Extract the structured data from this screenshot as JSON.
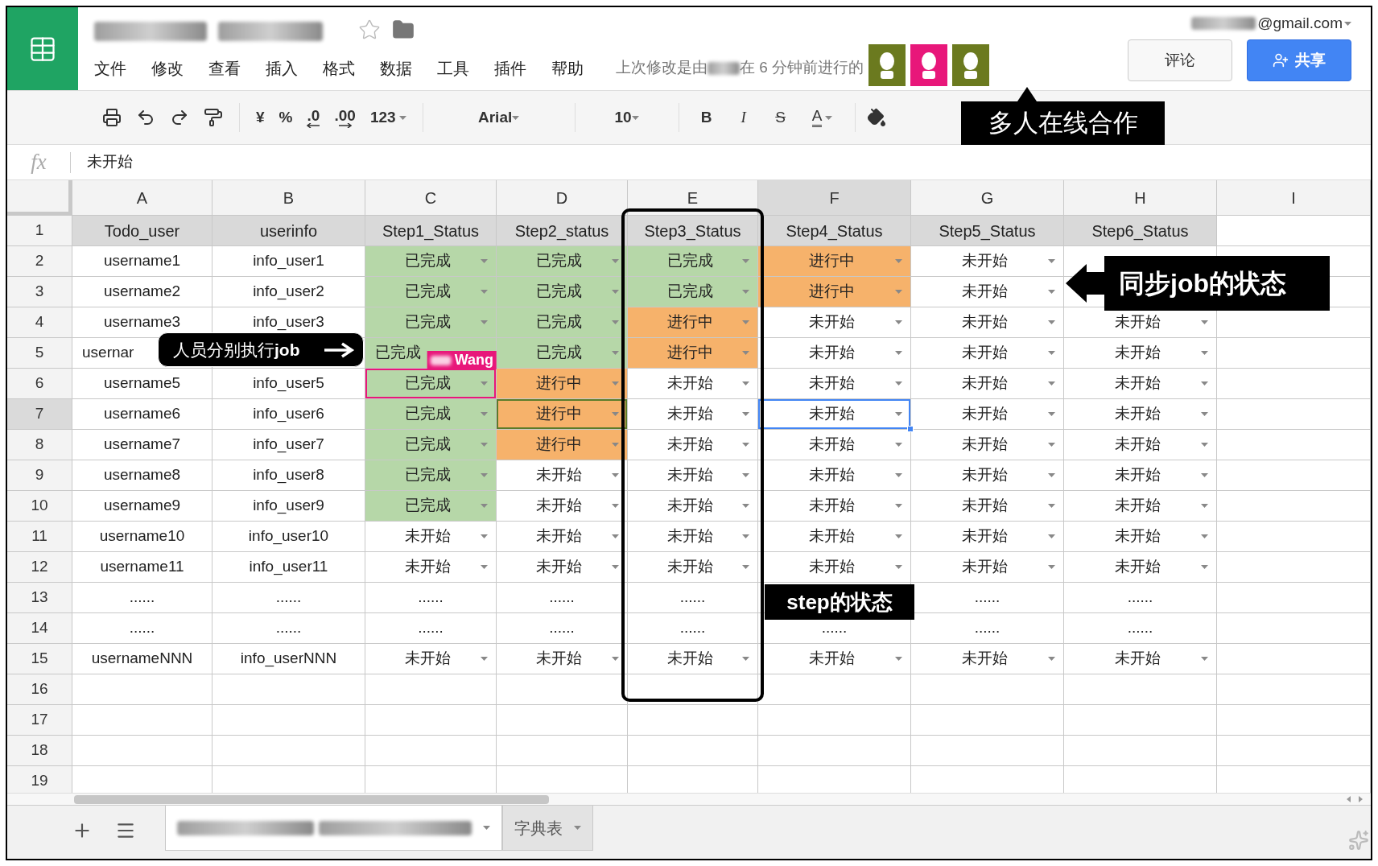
{
  "menu": [
    "文件",
    "修改",
    "查看",
    "插入",
    "格式",
    "数据",
    "工具",
    "插件",
    "帮助"
  ],
  "last_edit": {
    "prefix": "上次修改是由",
    "suffix": "在 6 分钟前进行的"
  },
  "collaborators": [
    {
      "color": "#6b7a1f"
    },
    {
      "color": "#e8177a"
    },
    {
      "color": "#6b7a1f"
    }
  ],
  "account": "@gmail.com",
  "buttons": {
    "comment": "评论",
    "share": "共享"
  },
  "toolbar": {
    "currency": "¥",
    "percent": "%",
    "dec_less": ".0",
    "dec_more": ".00",
    "number_format": "123",
    "font": "Arial",
    "size": "10",
    "bold": "B",
    "italic": "I",
    "strike": "S",
    "text_color": "A"
  },
  "formula": {
    "fx": "fx",
    "value": "未开始"
  },
  "columns": [
    {
      "label": "A",
      "selected": false
    },
    {
      "label": "B",
      "selected": false
    },
    {
      "label": "C",
      "selected": false
    },
    {
      "label": "D",
      "selected": false
    },
    {
      "label": "E",
      "selected": false
    },
    {
      "label": "F",
      "selected": true
    },
    {
      "label": "G",
      "selected": false
    },
    {
      "label": "H",
      "selected": false
    },
    {
      "label": "I",
      "selected": false
    }
  ],
  "rows": [
    {
      "number": "1",
      "selected": false,
      "cells": [
        {
          "text": "Todo_user",
          "kind": "header",
          "selected": false
        },
        {
          "text": "userinfo",
          "kind": "header",
          "selected": false
        },
        {
          "text": "Step1_Status",
          "kind": "header",
          "selected": false
        },
        {
          "text": "Step2_status",
          "kind": "header",
          "selected": false
        },
        {
          "text": "Step3_Status",
          "kind": "header",
          "selected": false
        },
        {
          "text": "Step4_Status",
          "kind": "header",
          "selected": false
        },
        {
          "text": "Step5_Status",
          "kind": "header",
          "selected": false
        },
        {
          "text": "Step6_Status",
          "kind": "header",
          "selected": false
        }
      ]
    },
    {
      "number": "2",
      "selected": false,
      "cells": [
        {
          "text": "username1",
          "kind": "plain",
          "selected": false
        },
        {
          "text": "info_user1",
          "kind": "plain",
          "selected": false
        },
        {
          "text": "已完成",
          "kind": "dropdown",
          "color": "#b6d7a8",
          "selected": false
        },
        {
          "text": "已完成",
          "kind": "dropdown",
          "color": "#b6d7a8",
          "selected": false
        },
        {
          "text": "已完成",
          "kind": "dropdown",
          "color": "#b6d7a8",
          "selected": false
        },
        {
          "text": "进行中",
          "kind": "dropdown",
          "color": "#f6b26b",
          "selected": false
        },
        {
          "text": "未开始",
          "kind": "dropdown",
          "color": "#ffffff",
          "selected": false
        }
      ]
    },
    {
      "number": "3",
      "selected": false,
      "cells": [
        {
          "text": "username2",
          "kind": "plain",
          "selected": false
        },
        {
          "text": "info_user2",
          "kind": "plain",
          "selected": false
        },
        {
          "text": "已完成",
          "kind": "dropdown",
          "color": "#b6d7a8",
          "selected": false
        },
        {
          "text": "已完成",
          "kind": "dropdown",
          "color": "#b6d7a8",
          "selected": false
        },
        {
          "text": "已完成",
          "kind": "dropdown",
          "color": "#b6d7a8",
          "selected": false
        },
        {
          "text": "进行中",
          "kind": "dropdown",
          "color": "#f6b26b",
          "selected": false
        },
        {
          "text": "未开始",
          "kind": "dropdown",
          "color": "#ffffff",
          "selected": false
        }
      ]
    },
    {
      "number": "4",
      "selected": false,
      "cells": [
        {
          "text": "username3",
          "kind": "plain",
          "selected": false
        },
        {
          "text": "info_user3",
          "kind": "plain",
          "selected": false
        },
        {
          "text": "已完成",
          "kind": "dropdown",
          "color": "#b6d7a8",
          "selected": false
        },
        {
          "text": "已完成",
          "kind": "dropdown",
          "color": "#b6d7a8",
          "selected": false
        },
        {
          "text": "进行中",
          "kind": "dropdown",
          "color": "#f6b26b",
          "selected": false
        },
        {
          "text": "未开始",
          "kind": "dropdown",
          "color": "#ffffff",
          "selected": false
        },
        {
          "text": "未开始",
          "kind": "dropdown",
          "color": "#ffffff",
          "selected": false
        },
        {
          "text": "未开始",
          "kind": "dropdown",
          "color": "#ffffff",
          "selected": false
        }
      ]
    },
    {
      "number": "5",
      "selected": false,
      "cells": [
        {
          "text": "usernar",
          "kind": "partial",
          "selected": false
        },
        {
          "kind": "covered"
        },
        {
          "text": "已完成",
          "kind": "partial",
          "color": "#b6d7a8",
          "selected": false
        },
        {
          "text": "已完成",
          "kind": "dropdown",
          "color": "#b6d7a8",
          "selected": false
        },
        {
          "text": "进行中",
          "kind": "dropdown",
          "color": "#f6b26b",
          "selected": false
        },
        {
          "text": "未开始",
          "kind": "dropdown",
          "color": "#ffffff",
          "selected": false
        },
        {
          "text": "未开始",
          "kind": "dropdown",
          "color": "#ffffff",
          "selected": false
        },
        {
          "text": "未开始",
          "kind": "dropdown",
          "color": "#ffffff",
          "selected": false
        }
      ]
    },
    {
      "number": "6",
      "selected": false,
      "cells": [
        {
          "text": "username5",
          "kind": "plain",
          "selected": false
        },
        {
          "text": "info_user5",
          "kind": "plain",
          "selected": false
        },
        {
          "text": "已完成",
          "kind": "dropdown",
          "color": "#b6d7a8",
          "selected": false,
          "collaborator": {
            "name": "Wang",
            "color": "#e8177a"
          }
        },
        {
          "text": "进行中",
          "kind": "dropdown",
          "color": "#f6b26b",
          "selected": false
        },
        {
          "text": "未开始",
          "kind": "dropdown",
          "color": "#ffffff",
          "selected": false
        },
        {
          "text": "未开始",
          "kind": "dropdown",
          "color": "#ffffff",
          "selected": false
        },
        {
          "text": "未开始",
          "kind": "dropdown",
          "color": "#ffffff",
          "selected": false
        },
        {
          "text": "未开始",
          "kind": "dropdown",
          "color": "#ffffff",
          "selected": false
        }
      ]
    },
    {
      "number": "7",
      "selected": true,
      "cells": [
        {
          "text": "username6",
          "kind": "plain",
          "selected": false
        },
        {
          "text": "info_user6",
          "kind": "plain",
          "selected": false
        },
        {
          "text": "已完成",
          "kind": "dropdown",
          "color": "#b6d7a8",
          "selected": false
        },
        {
          "text": "进行中",
          "kind": "dropdown",
          "color": "#f6b26b",
          "selected": false,
          "collaborator": {
            "color": "#5b7b2a"
          }
        },
        {
          "text": "未开始",
          "kind": "dropdown",
          "color": "#ffffff",
          "selected": false
        },
        {
          "text": "未开始",
          "kind": "dropdown",
          "color": "#ffffff",
          "selected": true
        },
        {
          "text": "未开始",
          "kind": "dropdown",
          "color": "#ffffff",
          "selected": false
        },
        {
          "text": "未开始",
          "kind": "dropdown",
          "color": "#ffffff",
          "selected": false
        }
      ]
    },
    {
      "number": "8",
      "selected": false,
      "cells": [
        {
          "text": "username7",
          "kind": "plain",
          "selected": false
        },
        {
          "text": "info_user7",
          "kind": "plain",
          "selected": false
        },
        {
          "text": "已完成",
          "kind": "dropdown",
          "color": "#b6d7a8",
          "selected": false
        },
        {
          "text": "进行中",
          "kind": "dropdown",
          "color": "#f6b26b",
          "selected": false
        },
        {
          "text": "未开始",
          "kind": "dropdown",
          "color": "#ffffff",
          "selected": false
        },
        {
          "text": "未开始",
          "kind": "dropdown",
          "color": "#ffffff",
          "selected": false
        },
        {
          "text": "未开始",
          "kind": "dropdown",
          "color": "#ffffff",
          "selected": false
        },
        {
          "text": "未开始",
          "kind": "dropdown",
          "color": "#ffffff",
          "selected": false
        }
      ]
    },
    {
      "number": "9",
      "selected": false,
      "cells": [
        {
          "text": "username8",
          "kind": "plain",
          "selected": false
        },
        {
          "text": "info_user8",
          "kind": "plain",
          "selected": false
        },
        {
          "text": "已完成",
          "kind": "dropdown",
          "color": "#b6d7a8",
          "selected": false
        },
        {
          "text": "未开始",
          "kind": "dropdown",
          "color": "#ffffff",
          "selected": false
        },
        {
          "text": "未开始",
          "kind": "dropdown",
          "color": "#ffffff",
          "selected": false
        },
        {
          "text": "未开始",
          "kind": "dropdown",
          "color": "#ffffff",
          "selected": false
        },
        {
          "text": "未开始",
          "kind": "dropdown",
          "color": "#ffffff",
          "selected": false
        },
        {
          "text": "未开始",
          "kind": "dropdown",
          "color": "#ffffff",
          "selected": false
        }
      ]
    },
    {
      "number": "10",
      "selected": false,
      "cells": [
        {
          "text": "username9",
          "kind": "plain",
          "selected": false
        },
        {
          "text": "info_user9",
          "kind": "plain",
          "selected": false
        },
        {
          "text": "已完成",
          "kind": "dropdown",
          "color": "#b6d7a8",
          "selected": false
        },
        {
          "text": "未开始",
          "kind": "dropdown",
          "color": "#ffffff",
          "selected": false
        },
        {
          "text": "未开始",
          "kind": "dropdown",
          "color": "#ffffff",
          "selected": false
        },
        {
          "text": "未开始",
          "kind": "dropdown",
          "color": "#ffffff",
          "selected": false
        },
        {
          "text": "未开始",
          "kind": "dropdown",
          "color": "#ffffff",
          "selected": false
        },
        {
          "text": "未开始",
          "kind": "dropdown",
          "color": "#ffffff",
          "selected": false
        }
      ]
    },
    {
      "number": "11",
      "selected": false,
      "cells": [
        {
          "text": "username10",
          "kind": "plain",
          "selected": false
        },
        {
          "text": "info_user10",
          "kind": "plain",
          "selected": false
        },
        {
          "text": "未开始",
          "kind": "dropdown",
          "color": "#ffffff",
          "selected": false
        },
        {
          "text": "未开始",
          "kind": "dropdown",
          "color": "#ffffff",
          "selected": false
        },
        {
          "text": "未开始",
          "kind": "dropdown",
          "color": "#ffffff",
          "selected": false
        },
        {
          "text": "未开始",
          "kind": "dropdown",
          "color": "#ffffff",
          "selected": false
        },
        {
          "text": "未开始",
          "kind": "dropdown",
          "color": "#ffffff",
          "selected": false
        },
        {
          "text": "未开始",
          "kind": "dropdown",
          "color": "#ffffff",
          "selected": false
        }
      ]
    },
    {
      "number": "12",
      "selected": false,
      "cells": [
        {
          "text": "username11",
          "kind": "plain",
          "selected": false
        },
        {
          "text": "info_user11",
          "kind": "plain",
          "selected": false
        },
        {
          "text": "未开始",
          "kind": "dropdown",
          "color": "#ffffff",
          "selected": false
        },
        {
          "text": "未开始",
          "kind": "dropdown",
          "color": "#ffffff",
          "selected": false
        },
        {
          "text": "未开始",
          "kind": "dropdown",
          "color": "#ffffff",
          "selected": false
        },
        {
          "text": "未开始",
          "kind": "dropdown",
          "color": "#ffffff",
          "selected": false
        },
        {
          "text": "未开始",
          "kind": "dropdown",
          "color": "#ffffff",
          "selected": false
        },
        {
          "text": "未开始",
          "kind": "dropdown",
          "color": "#ffffff",
          "selected": false
        }
      ]
    },
    {
      "number": "13",
      "selected": false,
      "cells": [
        {
          "text": "......",
          "kind": "plain",
          "selected": false
        },
        {
          "text": "......",
          "kind": "plain",
          "selected": false
        },
        {
          "text": "......",
          "kind": "plain",
          "selected": false
        },
        {
          "text": "......",
          "kind": "plain",
          "selected": false
        },
        {
          "text": "......",
          "kind": "plain",
          "selected": false
        },
        {
          "kind": "covered"
        },
        {
          "text": "......",
          "kind": "plain",
          "selected": false
        },
        {
          "text": "......",
          "kind": "plain",
          "selected": false
        }
      ]
    },
    {
      "number": "14",
      "selected": false,
      "cells": [
        {
          "text": "......",
          "kind": "plain",
          "selected": false
        },
        {
          "text": "......",
          "kind": "plain",
          "selected": false
        },
        {
          "text": "......",
          "kind": "plain",
          "selected": false
        },
        {
          "text": "......",
          "kind": "plain",
          "selected": false
        },
        {
          "text": "......",
          "kind": "plain",
          "selected": false
        },
        {
          "text": "......",
          "kind": "plain",
          "selected": false
        },
        {
          "text": "......",
          "kind": "plain",
          "selected": false
        },
        {
          "text": "......",
          "kind": "plain",
          "selected": false
        }
      ]
    },
    {
      "number": "15",
      "selected": false,
      "cells": [
        {
          "text": "usernameNNN",
          "kind": "plain",
          "selected": false
        },
        {
          "text": "info_userNNN",
          "kind": "plain",
          "selected": false
        },
        {
          "text": "未开始",
          "kind": "dropdown",
          "color": "#ffffff",
          "selected": false
        },
        {
          "text": "未开始",
          "kind": "dropdown",
          "color": "#ffffff",
          "selected": false
        },
        {
          "text": "未开始",
          "kind": "dropdown",
          "color": "#ffffff",
          "selected": false
        },
        {
          "text": "未开始",
          "kind": "dropdown",
          "color": "#ffffff",
          "selected": false
        },
        {
          "text": "未开始",
          "kind": "dropdown",
          "color": "#ffffff",
          "selected": false
        },
        {
          "text": "未开始",
          "kind": "dropdown",
          "color": "#ffffff",
          "selected": false
        }
      ]
    },
    {
      "number": "16",
      "selected": false
    },
    {
      "number": "17",
      "selected": false
    },
    {
      "number": "18",
      "selected": false
    },
    {
      "number": "19",
      "selected": false
    }
  ],
  "sheet_tabs": [
    {
      "selected": true
    },
    {
      "label": "字典表",
      "selected": false
    }
  ],
  "annotations": [
    {
      "kind": "callout_up",
      "text": "多人在线合作"
    },
    {
      "kind": "callout_left",
      "text": "同步job的状态"
    },
    {
      "kind": "pill_arrow",
      "text": "人员分别执行**job**"
    },
    {
      "kind": "label",
      "text": "step的状态"
    },
    {
      "kind": "frame"
    }
  ]
}
